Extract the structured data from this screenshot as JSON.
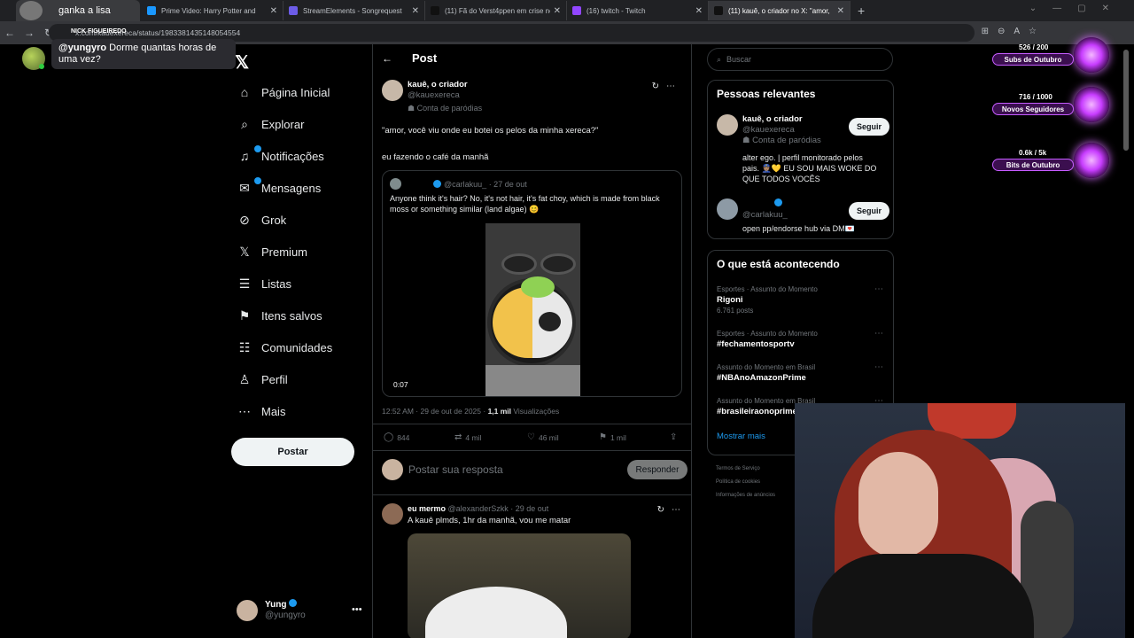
{
  "browser": {
    "streamer_tab": "ganka a lisa",
    "tabs": [
      {
        "title": "Prime Video: Harry Potter and",
        "color": "#1a98ff"
      },
      {
        "title": "StreamElements - Songrequest",
        "color": "#6c5ce7"
      },
      {
        "title": "(11) Fã do Verst4ppen em crise no",
        "color": "#111111"
      },
      {
        "title": "(16) twitch - Twitch",
        "color": "#9146ff"
      },
      {
        "title": "(11) kauê, o criador no X: \"amor,",
        "color": "#111111"
      }
    ],
    "url": "x.com/kauexereca/status/1983381435148054554",
    "nick_overlay": "NICK FIGUEIREDO"
  },
  "chat_popup": {
    "user": "@yungyro",
    "message": " Dorme quantas horas de uma vez?"
  },
  "nav": {
    "items": [
      {
        "label": "Página Inicial",
        "icon": "home-icon",
        "glyph": "⌂"
      },
      {
        "label": "Explorar",
        "icon": "search-icon",
        "glyph": "⌕"
      },
      {
        "label": "Notificações",
        "icon": "bell-icon",
        "glyph": "♫"
      },
      {
        "label": "Mensagens",
        "icon": "mail-icon",
        "glyph": "✉"
      },
      {
        "label": "Grok",
        "icon": "grok-icon",
        "glyph": "⊘"
      },
      {
        "label": "Premium",
        "icon": "x-premium-icon",
        "glyph": "𝕏"
      },
      {
        "label": "Listas",
        "icon": "list-icon",
        "glyph": "☰"
      },
      {
        "label": "Itens salvos",
        "icon": "bookmark-icon",
        "glyph": "⚑"
      },
      {
        "label": "Comunidades",
        "icon": "communities-icon",
        "glyph": "☷"
      },
      {
        "label": "Perfil",
        "icon": "profile-icon",
        "glyph": "♙"
      },
      {
        "label": "Mais",
        "icon": "more-icon",
        "glyph": "⋯"
      }
    ],
    "post_button": "Postar",
    "account_name": "Yung",
    "account_handle": "@yungyro"
  },
  "post": {
    "header": "Post",
    "author_name": "kauê, o criador",
    "author_handle": "@kauexereca",
    "parody_label": "Conta de paródias",
    "text1": "\"amor, você viu onde eu botei os pelos da minha xereca?\"",
    "text2": "eu fazendo o café da manhã",
    "quote": {
      "handle": "@carlakuu_",
      "date": "· 27 de out",
      "text": "Anyone think it's hair? No, it's not hair, it's fat choy, which is made from black moss or something similar (land algae) 😊",
      "video_time": "0:07"
    },
    "time": "12:52 AM · 29 de out de 2025 · ",
    "views_count": "1,1 mil",
    "views_label": " Visualizações",
    "replies": "844",
    "reposts": "4 mil",
    "likes": "46 mil",
    "bookmarks": "1 mil",
    "reply_placeholder": "Postar sua resposta",
    "reply_button": "Responder",
    "reply": {
      "name": "eu mermo",
      "handle": "@alexanderSzkk",
      "date": "· 29 de out",
      "text": "A kauê plmds, 1hr da manhã, vou me matar"
    }
  },
  "right": {
    "search_placeholder": "Buscar",
    "relevant_title": "Pessoas relevantes",
    "people": [
      {
        "name": "kauê, o criador",
        "handle": "@kauexereca",
        "parody": "Conta de paródias",
        "bio": "alter ego. | perfil monitorado pelos pais. 👮🏽💛 EU SOU MAIS WOKE DO QUE TODOS VOCÊS",
        "button": "Seguir"
      },
      {
        "name": "",
        "handle": "@carlakuu_",
        "bio": "open pp/endorse hub via DM💌",
        "button": "Seguir"
      }
    ],
    "happening_title": "O que está acontecendo",
    "trends": [
      {
        "context": "Esportes · Assunto do Momento",
        "name": "Rigoni",
        "posts": "6.761 posts"
      },
      {
        "context": "Esportes · Assunto do Momento",
        "name": "#fechamentosportv",
        "posts": ""
      },
      {
        "context": "Assunto do Momento em Brasil",
        "name": "#NBAnoAmazonPrime",
        "posts": ""
      },
      {
        "context": "Assunto do Momento em Brasil",
        "name": "#brasileiraonoprime",
        "posts": ""
      }
    ],
    "show_more": "Mostrar mais",
    "footer": [
      "Termos de Serviço",
      "Política de cookies",
      "Informações de anúncios"
    ]
  },
  "goals": [
    {
      "count": "526 / 200",
      "label": "Subs de Outubro"
    },
    {
      "count": "716 / 1000",
      "label": "Novos Seguidores"
    },
    {
      "count": "0.6k / 5k",
      "label": "Bits de Outubro"
    }
  ]
}
